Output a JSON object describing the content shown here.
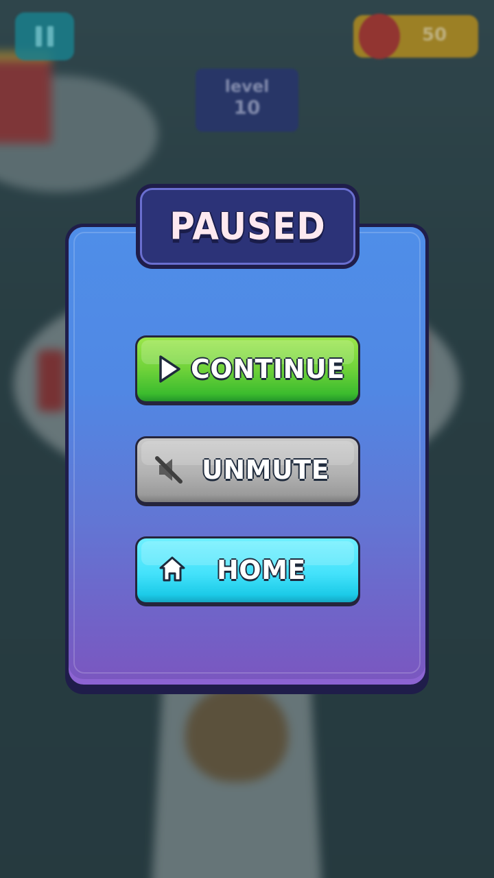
{
  "hud": {
    "level_label": "level",
    "level_value": "10",
    "gem_count": "50"
  },
  "pause_menu": {
    "title": "PAUSED",
    "buttons": [
      {
        "label": "CONTINUE",
        "icon": "play-icon",
        "color": "#6fd23a"
      },
      {
        "label": "UNMUTE",
        "icon": "muted-speaker-icon",
        "color": "#b2b2b2"
      },
      {
        "label": "HOME",
        "icon": "home-icon",
        "color": "#44e2fb"
      }
    ]
  },
  "colors": {
    "panel_top": "#4f8ee8",
    "panel_bottom": "#7a57c0",
    "title_tab": "#2c3378",
    "outline": "#1f1d4a"
  }
}
